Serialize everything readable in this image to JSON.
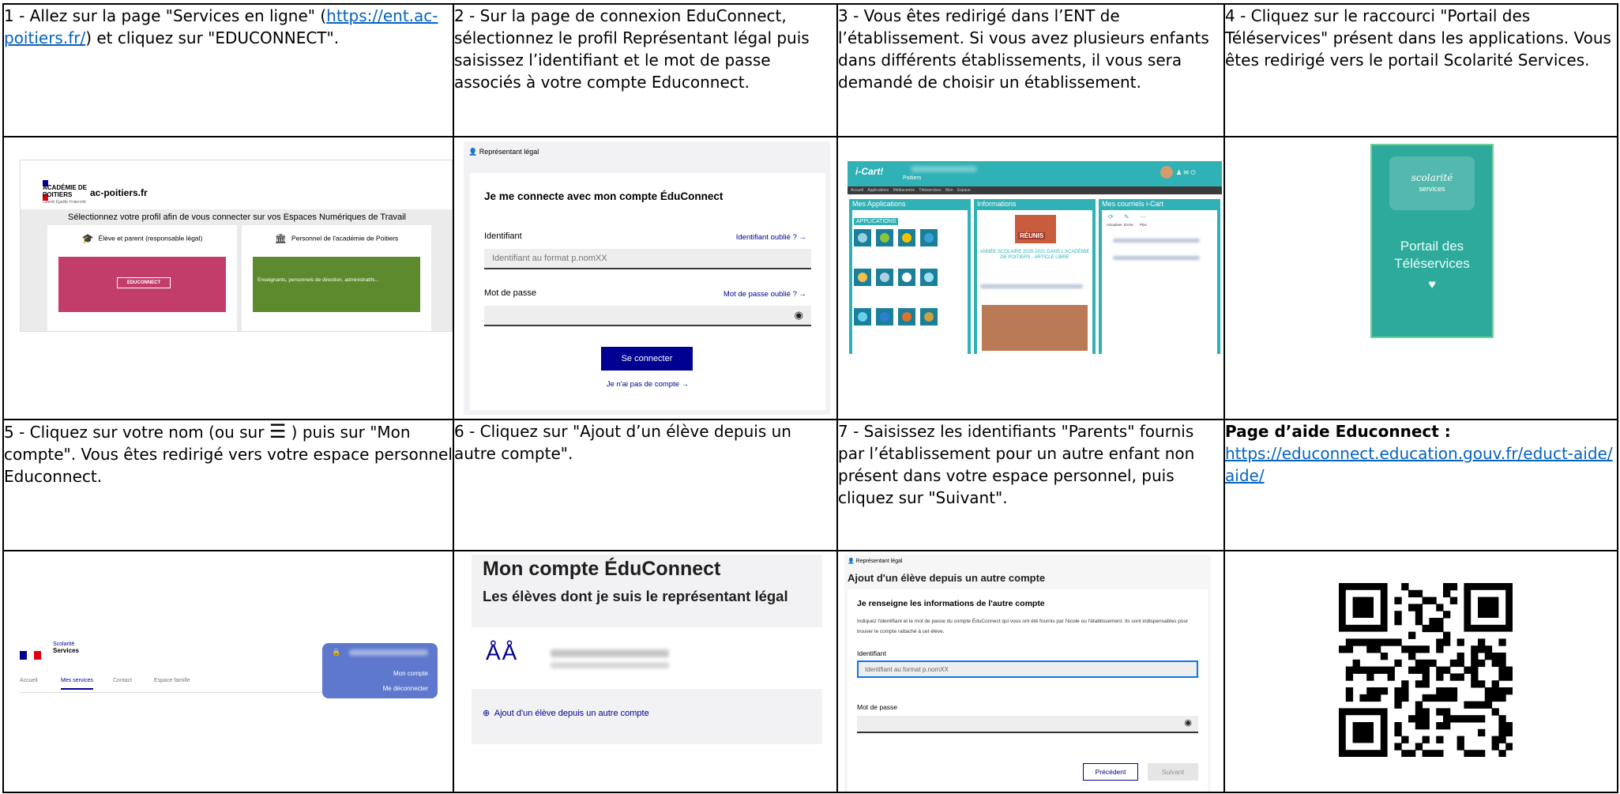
{
  "steps": [
    {
      "text_before": "1 - Allez sur la page \"Services en ligne\" (",
      "link": "https://ent.ac-poitiers.fr/",
      "text_after": ") et cliquez sur \"EDUCONNECT\"."
    },
    {
      "text": "2 - Sur la page de connexion EduConnect, sélectionnez le profil Représentant légal puis saisissez l’identifiant et le mot de passe associés à votre compte Educonnect."
    },
    {
      "text": "3 - Vous êtes redirigé dans l’ENT de l’établissement. Si vous avez plusieurs enfants dans différents établissements, il vous sera demandé de choisir un établissement."
    },
    {
      "text": "4 - Cliquez sur le raccourci \"Portail des Téléservices\" présent dans les applications. Vous êtes redirigé vers le portail Scolarité Services."
    },
    {
      "text_before": "5 - Cliquez sur votre nom (ou sur ",
      "icon_name": "hamburger-menu-icon",
      "icon_glyph": "☰",
      "text_after": " ) puis sur \"Mon compte\". Vous êtes redirigé vers votre espace personnel Educonnect."
    },
    {
      "text": "6 - Cliquez sur \"Ajout d’un élève depuis un autre compte\"."
    },
    {
      "text": "7 - Saisissez les identifiants \"Parents\" fournis par l’établissement pour un autre enfant non présent dans votre espace personnel, puis cliquez sur \"Suivant\"."
    }
  ],
  "help": {
    "title": "Page d’aide Educonnect :",
    "link": "https://educonnect.education.gouv.fr/educt-aide/aide/"
  },
  "shot1": {
    "academie": "ACADÉMIE DE POITIERS",
    "academie_sub": "Liberté Égalité Fraternité",
    "domain": "ac-poitiers.fr",
    "prompt": "Sélectionnez votre profil afin de vous connecter sur vos Espaces Numériques de Travail",
    "card1_title": "Élève et parent (responsable légal)",
    "card2_title": "Personnel de l'académie de Poitiers",
    "educonnect_button": "EDUCONNECT",
    "card2_text": "Enseignants, personnels de direction, administratifs..."
  },
  "shot2": {
    "profile": "Représentant légal",
    "heading": "Je me connecte avec mon compte ÉduConnect",
    "id_label": "Identifiant",
    "id_forgot": "Identifiant oublié ? →",
    "id_placeholder": "Identifiant au format p.nomXX",
    "pw_label": "Mot de passe",
    "pw_forgot": "Mot de passe oublié ? →",
    "submit": "Se connecter",
    "no_account": "Je n'ai pas de compte →"
  },
  "shot3": {
    "logo": "i-Cart!",
    "city": "Poitiers",
    "menu": "Accueil  Applications  Médiacentre  Téléservices  Mon Espace",
    "col1_title": "Mes Applications",
    "col2_title": "Informations",
    "col3_title": "Mes courriels i-Cart",
    "apps_label": "APPLICATIONS",
    "banner": "RÉUNIS",
    "annee": "ANNÉE SCOLAIRE 2020-2021 DANS L'ACADÉMIE DE POITIERS - ARTICLE LIBRE",
    "mail_actions": [
      "Actualiser",
      "Écrire",
      "Plus"
    ]
  },
  "shot4": {
    "scolarite": "scolarité",
    "services": "services",
    "portail_line1": "Portail des",
    "portail_line2": "Téléservices"
  },
  "shot5": {
    "brand_top": "Scolarité",
    "brand_bottom": "Services",
    "nav": [
      "Accueil",
      "Mes services",
      "Contact",
      "Espace famille"
    ],
    "mon_compte": "Mon compte",
    "deconnecter": "Me déconnecter"
  },
  "shot6": {
    "title": "Mon compte ÉduConnect",
    "subtitle": "Les élèves dont je suis le représentant légal",
    "add_link": "Ajout d'un élève depuis un autre compte"
  },
  "shot7": {
    "profile": "Représentant légal",
    "title": "Ajout d'un élève depuis un autre compte",
    "heading": "Je renseigne les informations de l'autre compte",
    "paragraph": "Indiquez l'identifiant et le mot de passe du compte ÉduConnect qui vous ont été fournis par l'école ou l'établissement. Ils sont indispensables pour trouver le compte rattaché à cet élève.",
    "id_label": "Identifiant",
    "id_placeholder": "Identifiant au format p.nomXX",
    "pw_label": "Mot de passe",
    "prev": "Précédent",
    "next": "Suivant"
  },
  "colors": {
    "link": "#0563c1",
    "educonnect_blue": "#000091",
    "icart_teal": "#2fb1b5",
    "teleservices_green": "#2eaa9d"
  }
}
